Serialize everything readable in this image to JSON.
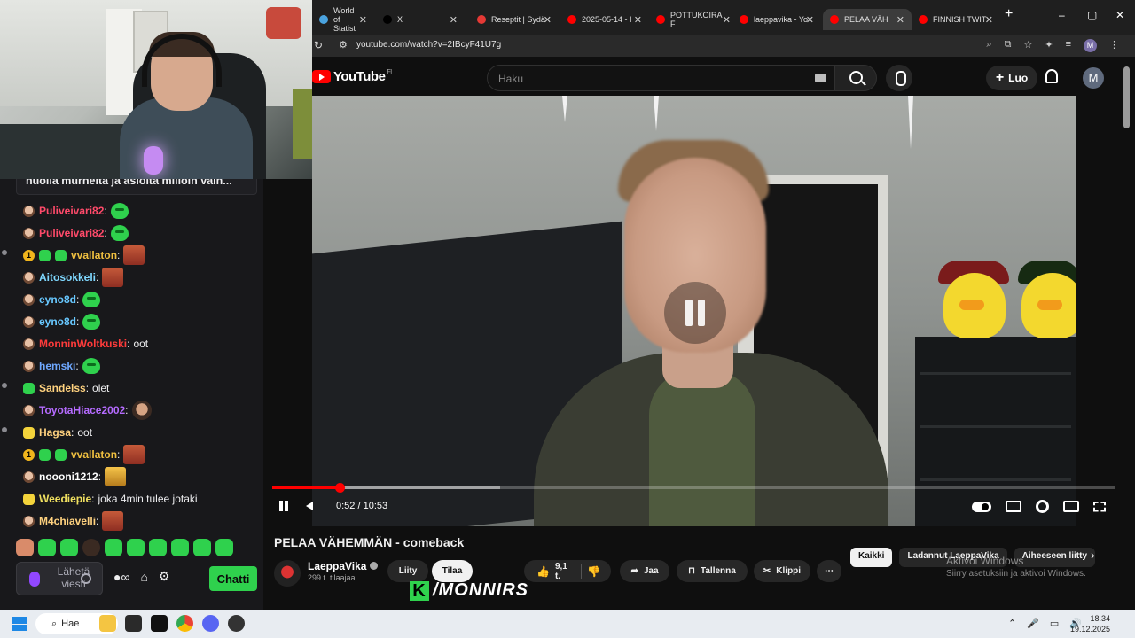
{
  "browser": {
    "tabs": [
      {
        "label": "World of Statist",
        "color": "#4aa3df"
      },
      {
        "label": "X",
        "color": "#000000"
      },
      {
        "label": "Reseptit | Sydä",
        "color": "#e53935"
      },
      {
        "label": "2025-05-14 - I",
        "color": "#ff0000"
      },
      {
        "label": "POTTUKOIRA F",
        "color": "#ff0000"
      },
      {
        "label": "laeppavika - Yo",
        "color": "#ff0000"
      },
      {
        "label": "PELAA VÄH",
        "color": "#ff0000"
      },
      {
        "label": "FINNISH TWIT",
        "color": "#ff0000"
      }
    ],
    "new_tab": "+",
    "url": "youtube.com/watch?v=2IBcyF41U7g"
  },
  "youtube": {
    "logo_text": "YouTube",
    "region": "FI",
    "search_placeholder": "Haku",
    "create_label": "Luo",
    "avatar_letter": "M",
    "video": {
      "title": "PELAA VÄHEMMÄN - comeback",
      "current_time": "0:52",
      "duration": "10:53",
      "time_display": "0:52 / 10:53",
      "progress_played_fraction": 0.08,
      "progress_buffered_fraction": 0.27
    },
    "channel": {
      "name": "LaeppaVika",
      "subscribers": "299 t. tilaajaa",
      "join_label": "Liity",
      "subscribe_label": "Tilaa"
    },
    "actions": {
      "likes": "9,1 t.",
      "share": "Jaa",
      "save": "Tallenna",
      "clip": "Klippi",
      "more": "⋯"
    },
    "chips": [
      "Kaikki",
      "Ladannut LaeppaVika",
      "Aiheeseen liitty"
    ],
    "windows_activation": {
      "title": "Aktivoi Windows",
      "subtitle": "Siirry asetuksiin ja aktivoi Windows."
    }
  },
  "overlay": {
    "brand": "/MONNIRS",
    "brand_mark": "K"
  },
  "chat": {
    "pinned": "huolia murheita ja asioita milloin vain...",
    "messages": [
      {
        "user": "Puliveivari82",
        "color": "#ff4a6a",
        "text": "",
        "emote": "frog",
        "badges": [
          "face"
        ]
      },
      {
        "user": "Puliveivari82",
        "color": "#ff4a6a",
        "text": "",
        "emote": "frog",
        "badges": [
          "face"
        ]
      },
      {
        "user": "vvallaton",
        "color": "#f0c040",
        "text": "",
        "emote": "face",
        "badges": [
          "gold",
          "frog",
          "frog"
        ],
        "gold_number": "1"
      },
      {
        "user": "Aitosokkeli",
        "color": "#7fd8ff",
        "text": "",
        "emote": "face",
        "badges": [
          "face"
        ]
      },
      {
        "user": "eyno8d",
        "color": "#68c8ff",
        "text": "",
        "emote": "frog",
        "badges": [
          "face"
        ]
      },
      {
        "user": "eyno8d",
        "color": "#68c8ff",
        "text": "",
        "emote": "frog",
        "badges": [
          "face"
        ]
      },
      {
        "user": "MonninWoltkuski",
        "color": "#ff3b3b",
        "text": "oot",
        "emote": "",
        "badges": [
          "face"
        ]
      },
      {
        "user": "hemski",
        "color": "#6fa8ff",
        "text": "",
        "emote": "frog",
        "badges": [
          "face"
        ]
      },
      {
        "user": "Sandelss",
        "color": "#ffd27f",
        "text": "olet",
        "emote": "",
        "badges": [
          "frog"
        ]
      },
      {
        "user": "ToyotaHiace2002",
        "color": "#b56bff",
        "text": "",
        "emote": "person",
        "badges": [
          "face"
        ]
      },
      {
        "user": "Hagsa",
        "color": "#ffd27f",
        "text": "oot",
        "emote": "",
        "badges": [
          "yell"
        ]
      },
      {
        "user": "vvallaton",
        "color": "#f0c040",
        "text": "",
        "emote": "face",
        "badges": [
          "gold",
          "frog",
          "frog"
        ],
        "gold_number": "1"
      },
      {
        "user": "noooni1212",
        "color": "#ffffff",
        "text": "",
        "emote": "gold",
        "badges": [
          "face"
        ]
      },
      {
        "user": "Weediepie",
        "color": "#f0e060",
        "text": "joka 4min tulee jotaki",
        "emote": "",
        "badges": [
          "yell"
        ]
      },
      {
        "user": "M4chiavelli",
        "color": "#ffd27f",
        "text": "",
        "emote": "face",
        "badges": [
          "face"
        ]
      }
    ],
    "input_placeholder": "Lähetä viesti",
    "chat_button": "Chatti"
  },
  "taskbar": {
    "search_label": "Hae",
    "time": "18.34",
    "date": "19.12.2025"
  }
}
